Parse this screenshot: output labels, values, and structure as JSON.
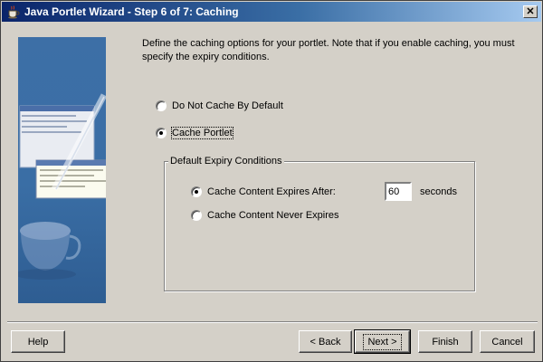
{
  "window": {
    "title": "Java Portlet Wizard - Step 6 of 7: Caching",
    "close_label": "✕"
  },
  "intro_text": "Define the caching options for your portlet. Note that if you enable caching, you must specify the expiry conditions.",
  "cache_mode": {
    "options": [
      {
        "label": "Do Not Cache By Default",
        "checked": false
      },
      {
        "label": "Cache Portlet",
        "checked": true
      }
    ]
  },
  "expiry_group": {
    "legend": "Default Expiry Conditions",
    "options": [
      {
        "label": "Cache Content Expires After:",
        "checked": true
      },
      {
        "label": "Cache Content Never Expires",
        "checked": false
      }
    ],
    "expires_value": "60",
    "unit_label": "seconds"
  },
  "buttons": {
    "help": "Help",
    "back": "< Back",
    "next": "Next >",
    "finish": "Finish",
    "cancel": "Cancel"
  },
  "colors": {
    "title_start": "#0a246a",
    "title_end": "#a6caf0",
    "dialog_bg": "#d4d0c8",
    "side_image_blue": "#3a6ea5"
  }
}
